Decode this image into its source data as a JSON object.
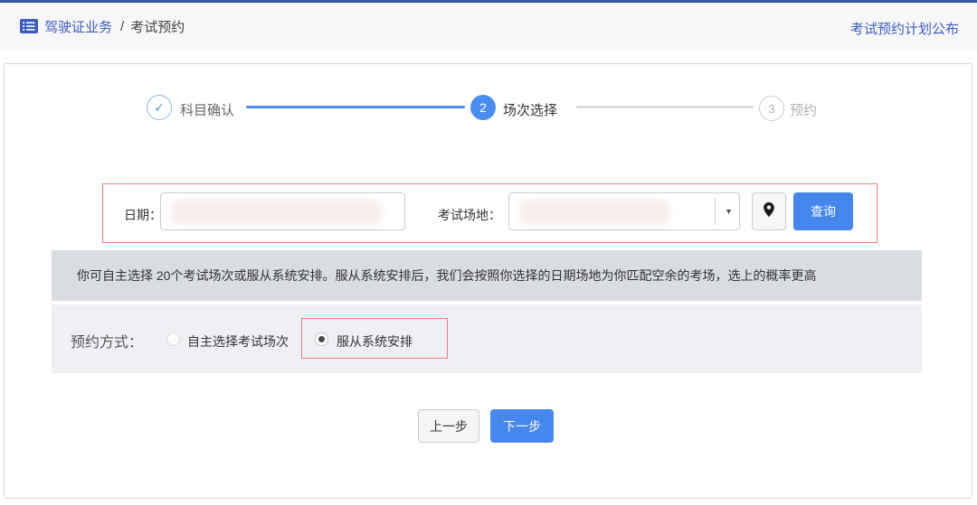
{
  "colors": {
    "topline_blue": "#3253a8",
    "header_bg": "#f7f7f8",
    "brand_blue": "#3a5dc0",
    "stepper_blue": "#4a8df0",
    "accent_blue": "#4687ee",
    "highlight_red": "#f47b7b",
    "notice_bg": "#d9dce1",
    "section_bg": "#eef0f4"
  },
  "header": {
    "section": "驾驶证业务",
    "separator": "/",
    "current": "考试预约",
    "plan_link": "考试预约计划公布"
  },
  "stepper": {
    "steps": [
      {
        "indicator": "✓",
        "label": "科目确认"
      },
      {
        "indicator": "2",
        "label": "场次选择"
      },
      {
        "indicator": "3",
        "label": "预约"
      }
    ]
  },
  "filter": {
    "date_label": "日期：",
    "venue_label": "考试场地：",
    "dropdown_arrow": "▼",
    "search_button": "查询"
  },
  "notice": {
    "text": "你可自主选择 20个考试场次或服从系统安排。服从系统安排后，我们会按照你选择的日期场地为你匹配空余的考场，选上的概率更高"
  },
  "booking": {
    "label": "预约方式：",
    "options": [
      {
        "label": "自主选择考试场次",
        "selected": false
      },
      {
        "label": "服从系统安排",
        "selected": true
      }
    ]
  },
  "actions": {
    "prev": "上一步",
    "next": "下一步"
  }
}
